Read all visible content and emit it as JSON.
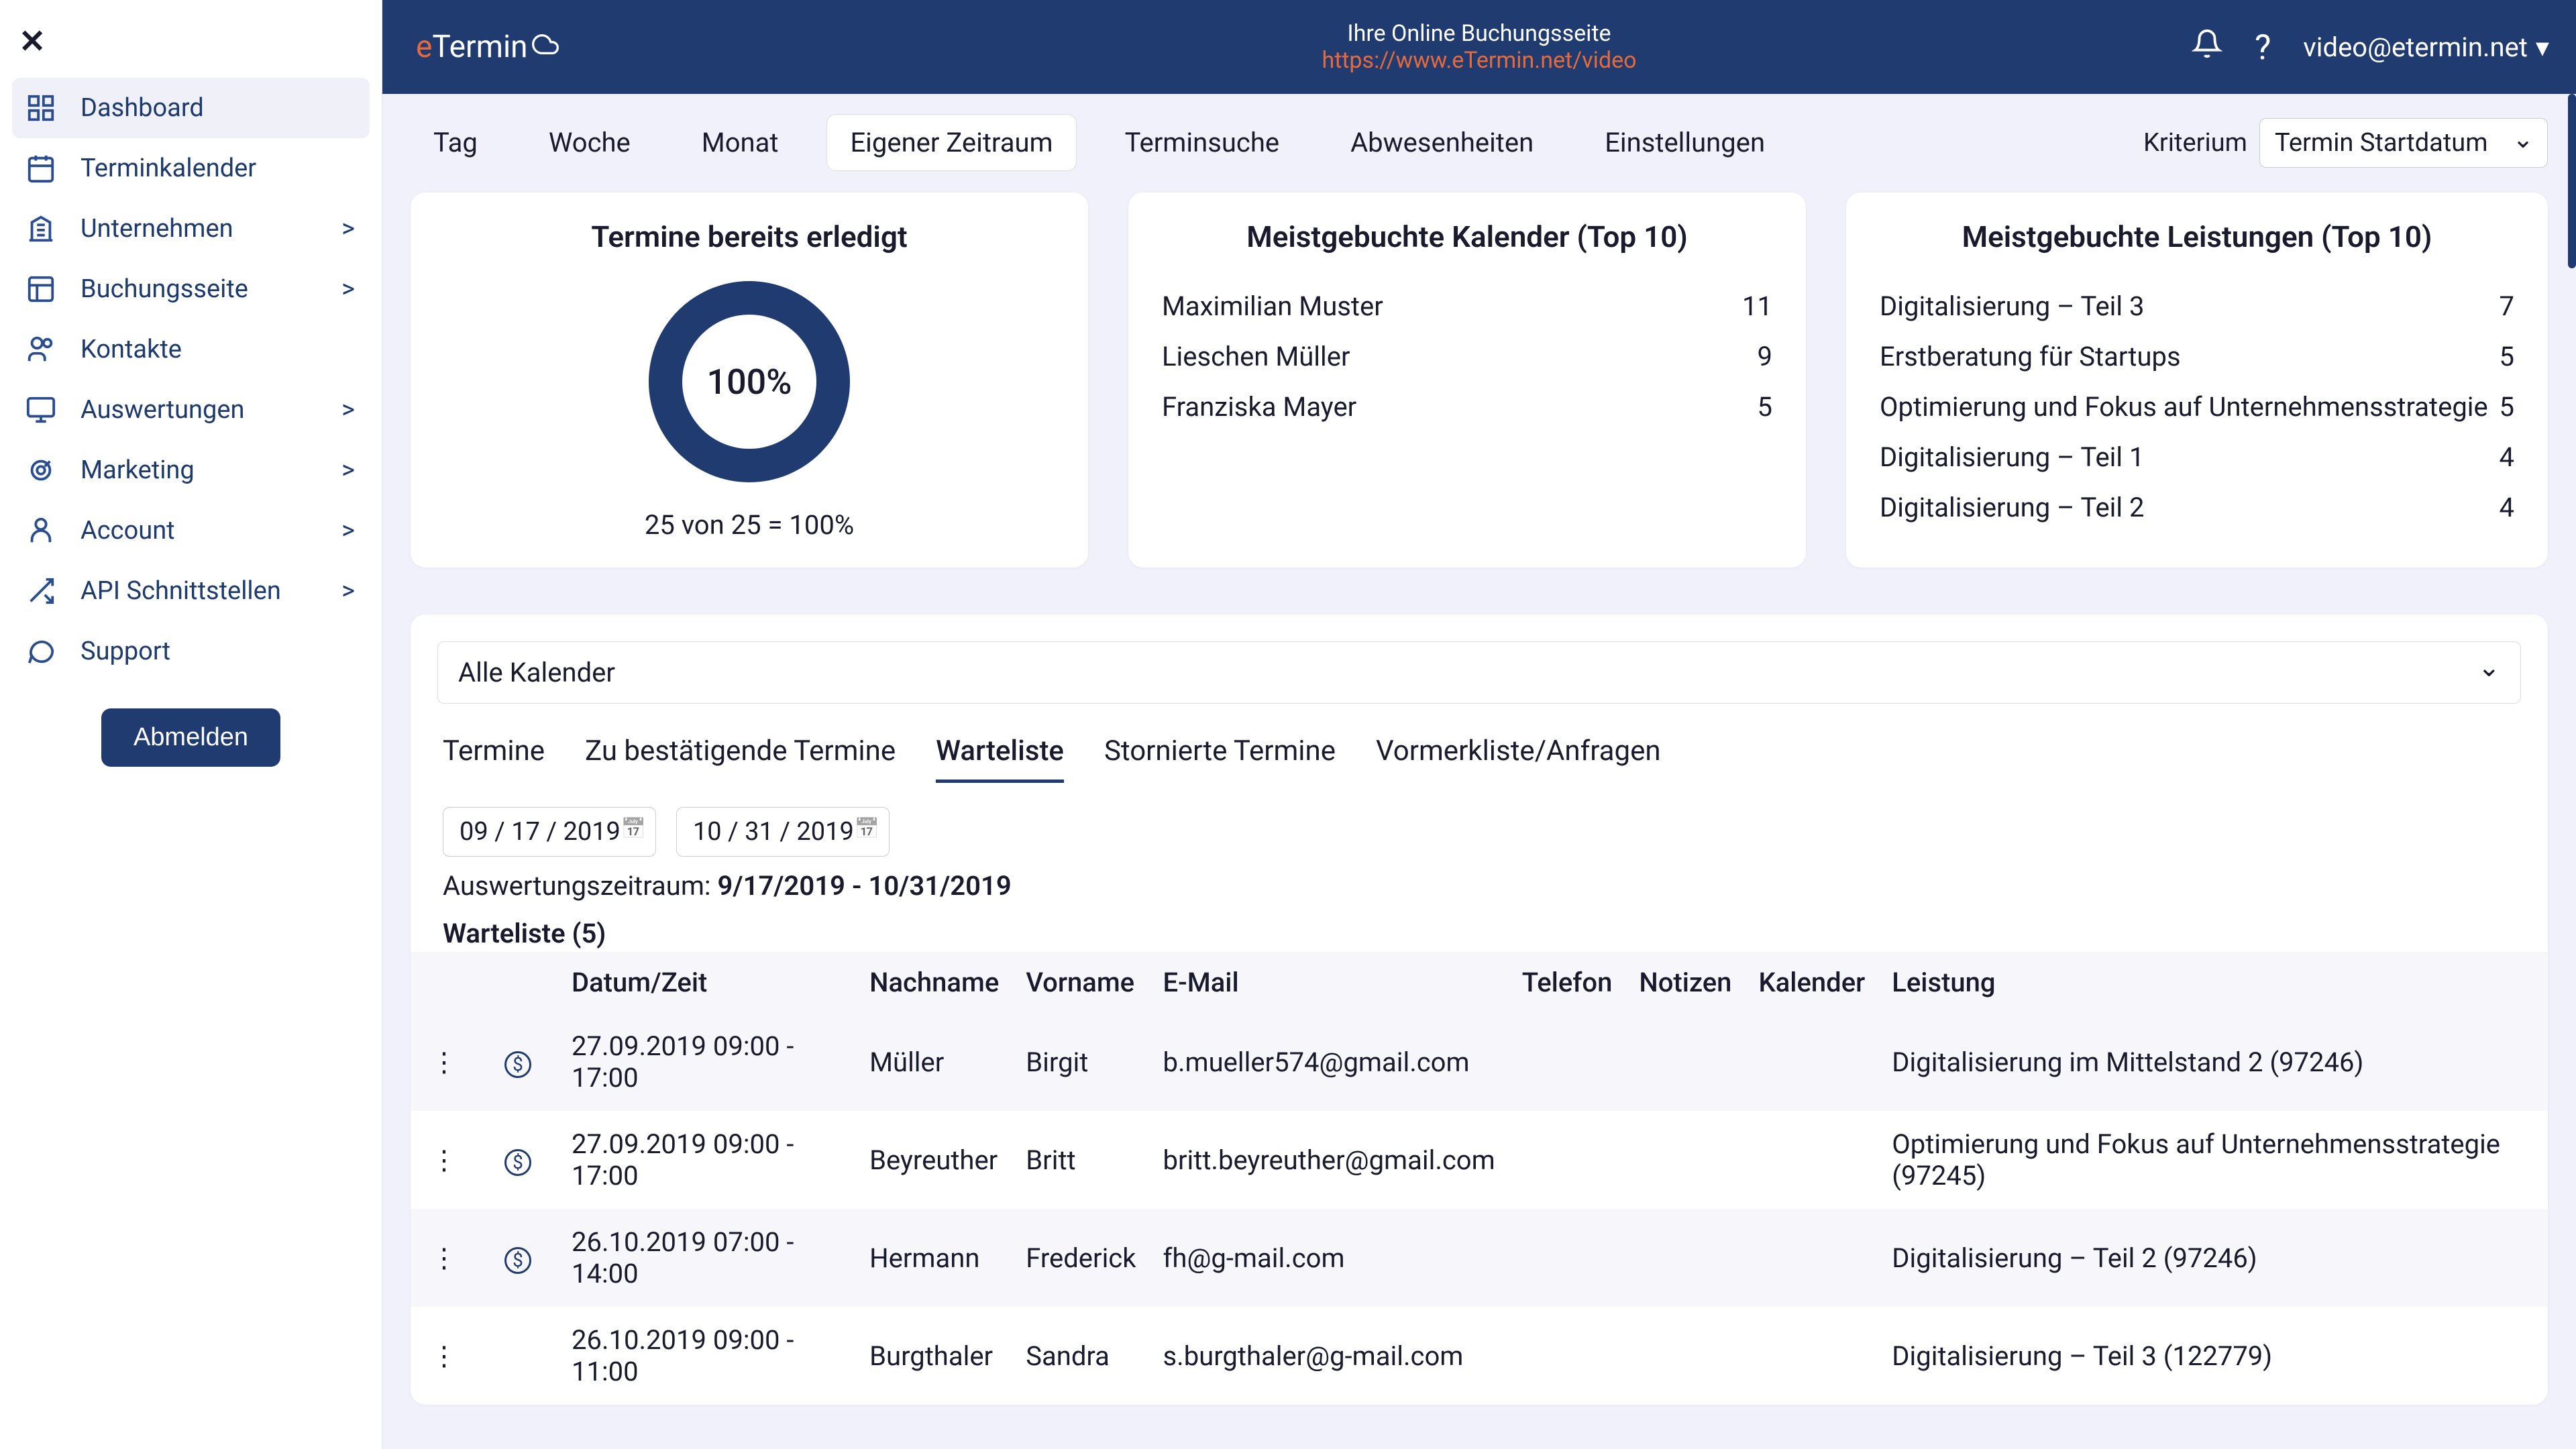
{
  "brand": {
    "e": "e",
    "rest": "Termin"
  },
  "top": {
    "line1": "Ihre Online Buchungsseite",
    "link": "https://www.eTermin.net/video",
    "user": "video@etermin.net"
  },
  "nav": [
    {
      "label": "Dashboard",
      "active": true,
      "expandable": false
    },
    {
      "label": "Terminkalender",
      "active": false,
      "expandable": false
    },
    {
      "label": "Unternehmen",
      "active": false,
      "expandable": true
    },
    {
      "label": "Buchungsseite",
      "active": false,
      "expandable": true
    },
    {
      "label": "Kontakte",
      "active": false,
      "expandable": false
    },
    {
      "label": "Auswertungen",
      "active": false,
      "expandable": true
    },
    {
      "label": "Marketing",
      "active": false,
      "expandable": true
    },
    {
      "label": "Account",
      "active": false,
      "expandable": true
    },
    {
      "label": "API Schnittstellen",
      "active": false,
      "expandable": true
    },
    {
      "label": "Support",
      "active": false,
      "expandable": false
    }
  ],
  "logout": "Abmelden",
  "viewTabs": [
    "Tag",
    "Woche",
    "Monat",
    "Eigener Zeitraum",
    "Terminsuche",
    "Abwesenheiten",
    "Einstellungen"
  ],
  "viewActive": "Eigener Zeitraum",
  "criterion": {
    "label": "Kriterium",
    "value": "Termin Startdatum"
  },
  "cardDone": {
    "title": "Termine bereits erledigt",
    "pct": "100%",
    "text": "25 von 25 = 100%"
  },
  "cardCal": {
    "title": "Meistgebuchte Kalender (Top 10)",
    "rows": [
      {
        "name": "Maximilian Muster",
        "count": "11"
      },
      {
        "name": "Lieschen Müller",
        "count": "9"
      },
      {
        "name": "Franziska Mayer",
        "count": "5"
      }
    ]
  },
  "cardServ": {
    "title": "Meistgebuchte Leistungen (Top 10)",
    "rows": [
      {
        "name": "Digitalisierung – Teil 3",
        "count": "7"
      },
      {
        "name": "Erstberatung für Startups",
        "count": "5"
      },
      {
        "name": "Optimierung und Fokus auf Unternehmensstrategie",
        "count": "5"
      },
      {
        "name": "Digitalisierung – Teil 1",
        "count": "4"
      },
      {
        "name": "Digitalisierung – Teil 2",
        "count": "4"
      }
    ]
  },
  "lower": {
    "calSelect": "Alle Kalender",
    "subTabs": [
      "Termine",
      "Zu bestätigende Termine",
      "Warteliste",
      "Stornierte Termine",
      "Vormerkliste/Anfragen"
    ],
    "subActive": "Warteliste",
    "dateFrom": "09 / 17 / 2019",
    "dateTo": "10 / 31 / 2019",
    "rangeLabel": "Auswertungszeitraum: ",
    "rangeValue": "9/17/2019 - 10/31/2019",
    "waitHead": "Warteliste (5)",
    "headers": {
      "dt": "Datum/Zeit",
      "ln": "Nachname",
      "fn": "Vorname",
      "em": "E-Mail",
      "tel": "Telefon",
      "note": "Notizen",
      "cal": "Kalender",
      "svc": "Leistung"
    },
    "rows": [
      {
        "pay": true,
        "dt": "27.09.2019 09:00 - 17:00",
        "ln": "Müller",
        "fn": "Birgit",
        "em": "b.mueller574@gmail.com",
        "tel": "",
        "note": "",
        "cal": "",
        "svc": "Digitalisierung im Mittelstand 2 (97246)"
      },
      {
        "pay": true,
        "dt": "27.09.2019 09:00 - 17:00",
        "ln": "Beyreuther",
        "fn": "Britt",
        "em": "britt.beyreuther@gmail.com",
        "tel": "",
        "note": "",
        "cal": "",
        "svc": "Optimierung und Fokus auf Unternehmensstrategie (97245)"
      },
      {
        "pay": true,
        "dt": "26.10.2019 07:00 - 14:00",
        "ln": "Hermann",
        "fn": "Frederick",
        "em": "fh@g-mail.com",
        "tel": "",
        "note": "",
        "cal": "",
        "svc": "Digitalisierung – Teil 2 (97246)"
      },
      {
        "pay": false,
        "dt": "26.10.2019 09:00 - 11:00",
        "ln": "Burgthaler",
        "fn": "Sandra",
        "em": "s.burgthaler@g-mail.com",
        "tel": "",
        "note": "",
        "cal": "",
        "svc": "Digitalisierung – Teil 3 (122779)"
      }
    ]
  }
}
